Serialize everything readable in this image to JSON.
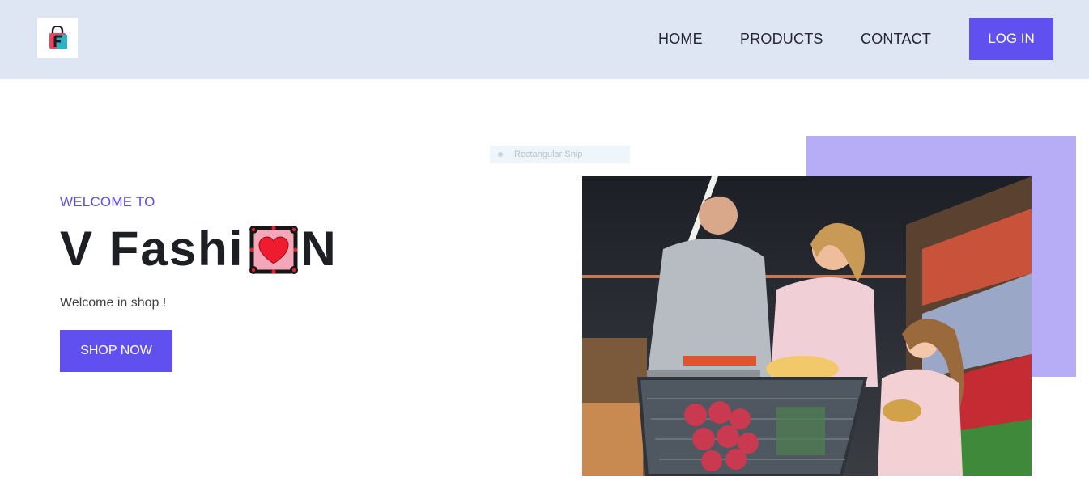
{
  "nav": {
    "logo_icon": "shopping-bag-f-logo-icon",
    "links": [
      "HOME",
      "PRODUCTS",
      "CONTACT"
    ],
    "login_label": "LOG IN",
    "colors": {
      "bar_bg": "#dfe6f3",
      "accent": "#6150f0"
    }
  },
  "hero": {
    "welcome_label": "WELCOME TO",
    "title_prefix": "V Fashi",
    "title_icon": "heart-frame-icon",
    "title_suffix": "N",
    "subtitle": "Welcome in shop !",
    "cta_label": "SHOP NOW",
    "image_alt": "Family shopping in a grocery store with a cart",
    "colors": {
      "welcome_text": "#5b4de8",
      "title_text": "#1e1f24",
      "decor_block": "#b7acf6"
    }
  },
  "overlay": {
    "snip_label": "Rectangular Snip"
  }
}
